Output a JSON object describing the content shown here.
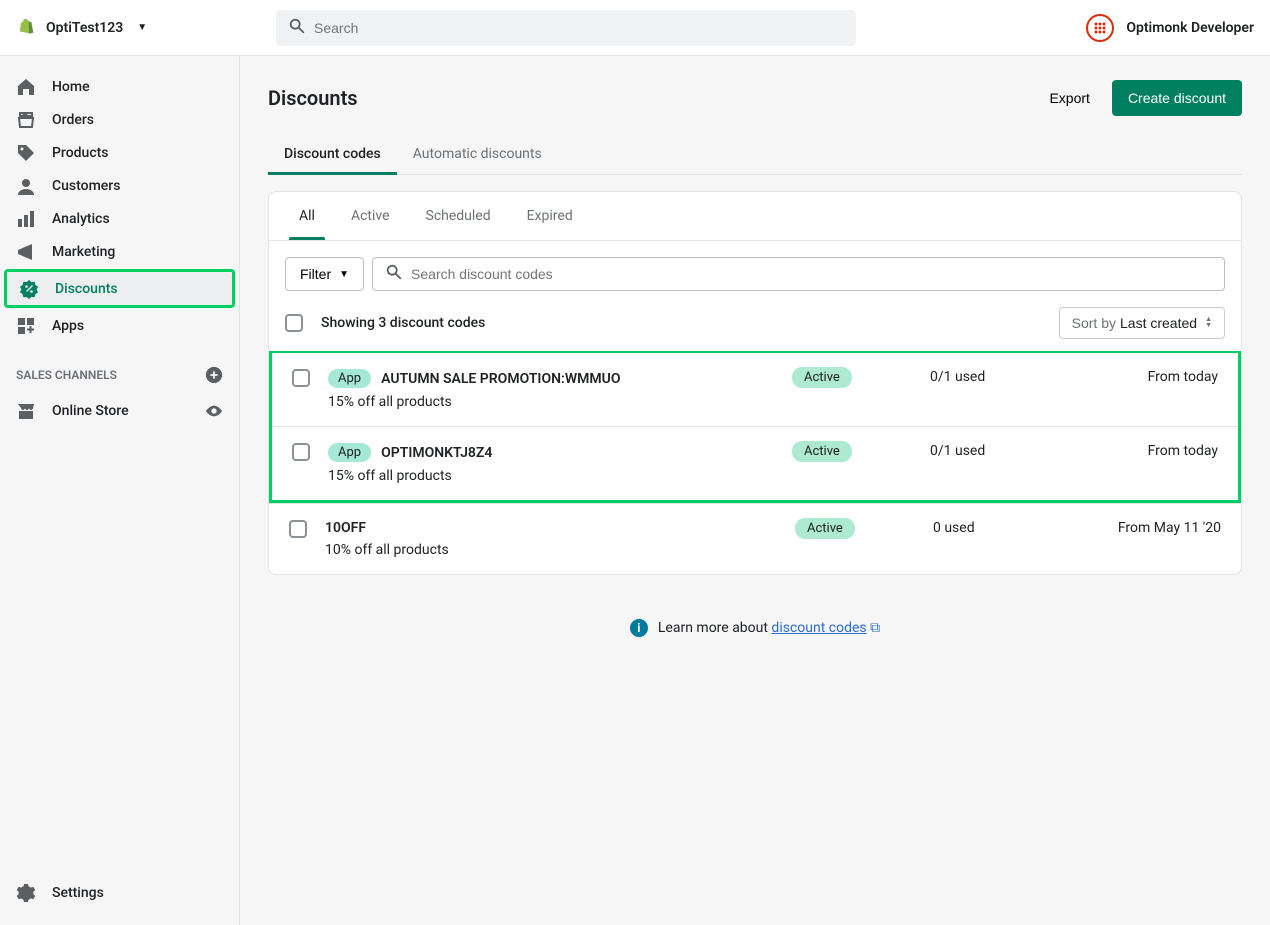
{
  "topbar": {
    "store_name": "OptiTest123",
    "search_placeholder": "Search",
    "user_name": "Optimonk Developer"
  },
  "sidebar": {
    "items": [
      {
        "label": "Home",
        "icon": "home-icon"
      },
      {
        "label": "Orders",
        "icon": "orders-icon"
      },
      {
        "label": "Products",
        "icon": "products-icon"
      },
      {
        "label": "Customers",
        "icon": "customers-icon"
      },
      {
        "label": "Analytics",
        "icon": "analytics-icon"
      },
      {
        "label": "Marketing",
        "icon": "marketing-icon"
      },
      {
        "label": "Discounts",
        "icon": "discounts-icon"
      },
      {
        "label": "Apps",
        "icon": "apps-icon"
      }
    ],
    "sales_channels_label": "SALES CHANNELS",
    "channels": [
      {
        "label": "Online Store"
      }
    ],
    "settings_label": "Settings"
  },
  "page": {
    "title": "Discounts",
    "export_label": "Export",
    "create_label": "Create discount",
    "tabs": [
      {
        "label": "Discount codes",
        "active": true
      },
      {
        "label": "Automatic discounts",
        "active": false
      }
    ]
  },
  "filters": {
    "tabs": [
      {
        "label": "All",
        "active": true
      },
      {
        "label": "Active",
        "active": false
      },
      {
        "label": "Scheduled",
        "active": false
      },
      {
        "label": "Expired",
        "active": false
      }
    ],
    "filter_button_label": "Filter",
    "search_placeholder": "Search discount codes"
  },
  "table": {
    "summary": "Showing 3 discount codes",
    "sort_label_prefix": "Sort by ",
    "sort_value": "Last created",
    "rows": [
      {
        "has_app_badge": true,
        "badge": "App",
        "title": "AUTUMN SALE PROMOTION:WMMUO",
        "desc": "15% off all products",
        "status": "Active",
        "used": "0/1 used",
        "date": "From today"
      },
      {
        "has_app_badge": true,
        "badge": "App",
        "title": "OPTIMONKTJ8Z4",
        "desc": "15% off all products",
        "status": "Active",
        "used": "0/1 used",
        "date": "From today"
      },
      {
        "has_app_badge": false,
        "title": "10OFF",
        "desc": "10% off all products",
        "status": "Active",
        "used": "0 used",
        "date": "From May 11 '20"
      }
    ]
  },
  "footer": {
    "learn_prefix": "Learn more about ",
    "learn_link": "discount codes"
  }
}
